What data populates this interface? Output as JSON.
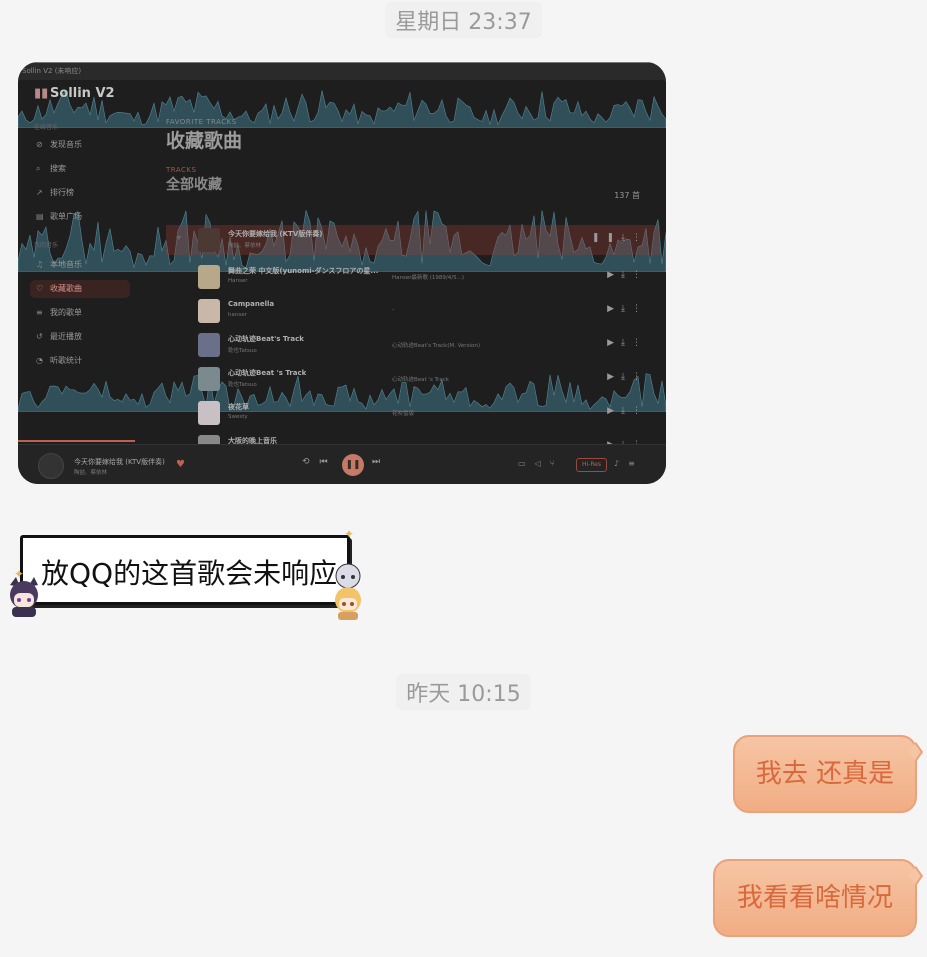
{
  "timestamps": [
    "星期日 23:37",
    "昨天 10:15"
  ],
  "screenshot": {
    "window_title": "Sollin V2 (未响应)",
    "app_name": "Sollin V2",
    "sidebar": {
      "section_label": "在线音乐",
      "items": [
        {
          "icon": "compass-icon",
          "label": "发现音乐"
        },
        {
          "icon": "search-icon",
          "label": "搜索"
        },
        {
          "icon": "chart-icon",
          "label": "排行榜"
        },
        {
          "icon": "playlist-icon",
          "label": "歌单广场"
        }
      ],
      "section_label_2": "我的音乐",
      "items2": [
        {
          "icon": "music-note-icon",
          "label": "本地音乐"
        },
        {
          "icon": "heart-icon",
          "label": "收藏歌曲",
          "active": true
        },
        {
          "icon": "list-icon",
          "label": "我的歌单"
        },
        {
          "icon": "history-icon",
          "label": "最近播放"
        },
        {
          "icon": "stats-icon",
          "label": "听歌统计"
        }
      ]
    },
    "header": {
      "eyebrow": "FAVORITE TRACKS",
      "title": "收藏歌曲",
      "sub_eyebrow": "TRACKS",
      "subtitle": "全部收藏",
      "count": "137 首"
    },
    "tracks": [
      {
        "title": "今天你要嫁给我 (KTV版伴奏)",
        "artist": "陶喆、蔡依林",
        "album": "",
        "playing": true,
        "cover": "#4a3a33"
      },
      {
        "title": "舞曲之荣 中文版(yunomi-ダンスフロアの星...",
        "artist": "Hanser",
        "album": "Hanser最新歌 (1989/4/5...)",
        "cover": "#b8a88a"
      },
      {
        "title": "Campanella",
        "artist": "hanser",
        "album": "-",
        "cover": "#c9b7a7"
      },
      {
        "title": "心动轨迹Beat's Track",
        "artist": "乾也Tatsuo",
        "album": "心动轨迹Beat's Track(M. Version)",
        "cover": "#6a6f8a"
      },
      {
        "title": "心动轨迹Beat  's Track",
        "artist": "乾也Tatsuo",
        "album": "心动轨迹Beat  's Track",
        "cover": "#7a8a8f"
      },
      {
        "title": "夜花草",
        "artist": "Swesty",
        "album": "花吹雪版",
        "cover": "#c8c0c4"
      },
      {
        "title": "大阪的晚上音乐",
        "artist": "",
        "album": "",
        "cover": "#888"
      }
    ],
    "player": {
      "song": "今天你要嫁给我 (KTV版伴奏)",
      "artist": "陶喆、蔡依林",
      "quality": "Hi-Res",
      "progress": 0.18
    }
  },
  "messages": {
    "sticker_text": "放QQ的这首歌会未响应",
    "out1": "我去 还真是",
    "out2": "我看看啥情况"
  }
}
